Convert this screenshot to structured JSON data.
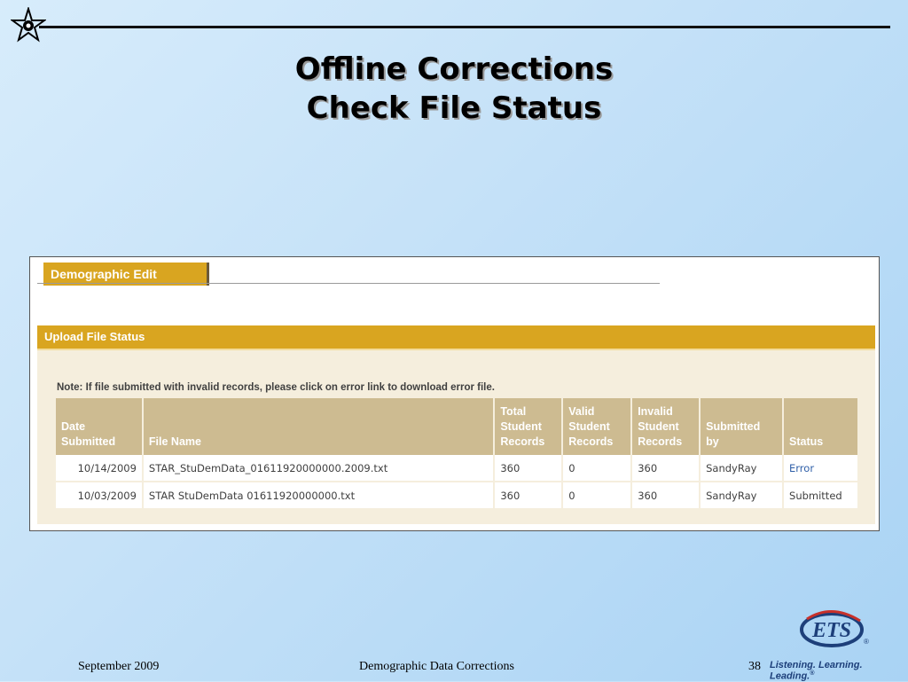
{
  "slide": {
    "title_line1": "Offline Corrections",
    "title_line2": "Check File Status"
  },
  "app": {
    "tab_label": "Demographic Edit",
    "panel_title": "Upload File Status",
    "note": "Note: If file submitted with invalid records, please click on error link to download error file.",
    "table": {
      "headers": {
        "date_submitted": [
          "Date",
          "Submitted"
        ],
        "file_name": "File Name",
        "total_records": [
          "Total",
          "Student",
          "Records"
        ],
        "valid_records": [
          "Valid",
          "Student",
          "Records"
        ],
        "invalid_records": [
          "Invalid",
          "Student",
          "Records"
        ],
        "submitted_by": [
          "Submitted",
          "by"
        ],
        "status": "Status"
      },
      "rows": [
        {
          "date": "10/14/2009",
          "file_name": "STAR_StuDemData_01611920000000.2009.txt",
          "total": "360",
          "valid": "0",
          "invalid": "360",
          "submitted_by": "SandyRay",
          "status": "Error"
        },
        {
          "date": "10/03/2009",
          "file_name": "STAR StuDemData 01611920000000.txt",
          "total": "360",
          "valid": "0",
          "invalid": "360",
          "submitted_by": "SandyRay",
          "status": "Submitted"
        }
      ]
    }
  },
  "footer": {
    "date": "September 2009",
    "center": "Demographic Data Corrections",
    "page": "38",
    "tagline": "Listening. Learning. Leading.",
    "tagline_mark": "®",
    "logo_text": "ETS",
    "logo_mark": "®"
  },
  "colors": {
    "accent_gold": "#d9a520",
    "header_tan": "#cdbb91",
    "link_blue": "#2f5fa8",
    "ets_blue": "#1d3f7a"
  }
}
